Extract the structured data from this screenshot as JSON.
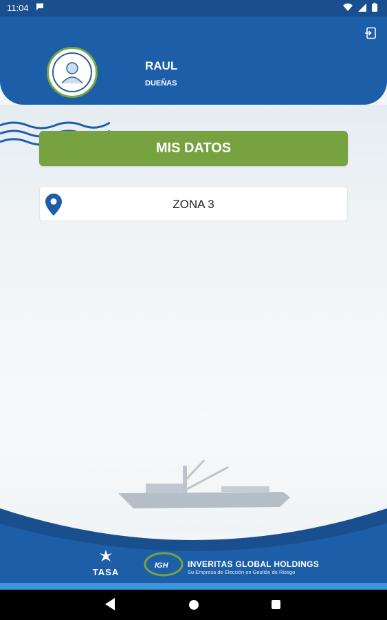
{
  "status_bar": {
    "time": "11:04",
    "icons": [
      "chat-icon",
      "wifi-icon",
      "signal-icon",
      "battery-icon"
    ]
  },
  "header": {
    "user_name": "RAUL",
    "user_role": "DUEÑAS",
    "logout_icon": "logout-icon",
    "accent_color": "#1d5ea8"
  },
  "main": {
    "mis_datos_label": "MIS DATOS",
    "zone_label": "ZONA 3",
    "button_color": "#76a240"
  },
  "footer": {
    "tasa_label": "TASA",
    "igh_badge": "IGH",
    "igh_title": "INVERITAS GLOBAL HOLDINGS",
    "igh_subtitle": "Su Empresa de Elección en Gestión de Riesgo"
  },
  "nav": {
    "icons": [
      "back-icon",
      "home-icon",
      "recent-apps-icon"
    ]
  }
}
